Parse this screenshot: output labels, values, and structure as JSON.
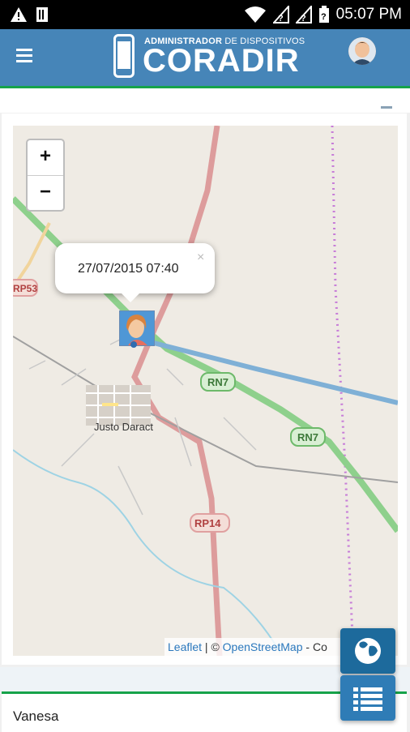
{
  "status_bar": {
    "time": "05:07 PM",
    "icons": [
      "warning-icon",
      "sim-icon",
      "wifi-icon",
      "no-signal-icon",
      "no-signal-icon",
      "battery-icon"
    ]
  },
  "header": {
    "menu_icon": "hamburger-icon",
    "logo_subtitle_bold": "ADMINISTRADOR",
    "logo_subtitle_rest": "DE DISPOSITIVOS",
    "logo_title": "CORADIR",
    "avatar_icon": "user-avatar-icon"
  },
  "map": {
    "zoom_in": "+",
    "zoom_out": "−",
    "popup_text": "27/07/2015 07:40",
    "popup_close": "×",
    "labels": {
      "rp53": "RP53",
      "rn7_a": "RN7",
      "rn7_b": "RN7",
      "rp14": "RP14",
      "town": "Justo Daract"
    },
    "attribution_leaflet": "Leaflet",
    "attribution_sep": " | © ",
    "attribution_osm": "OpenStreetMap",
    "attribution_rest": " - Co"
  },
  "fabs": {
    "globe_icon": "globe-icon",
    "list_icon": "list-icon"
  },
  "list": {
    "first_item": "Vanesa"
  },
  "colors": {
    "header": "#4685b8",
    "accent": "#16a34a",
    "fab": "#2f7cb6",
    "fab_dark": "#1d6a9c"
  }
}
